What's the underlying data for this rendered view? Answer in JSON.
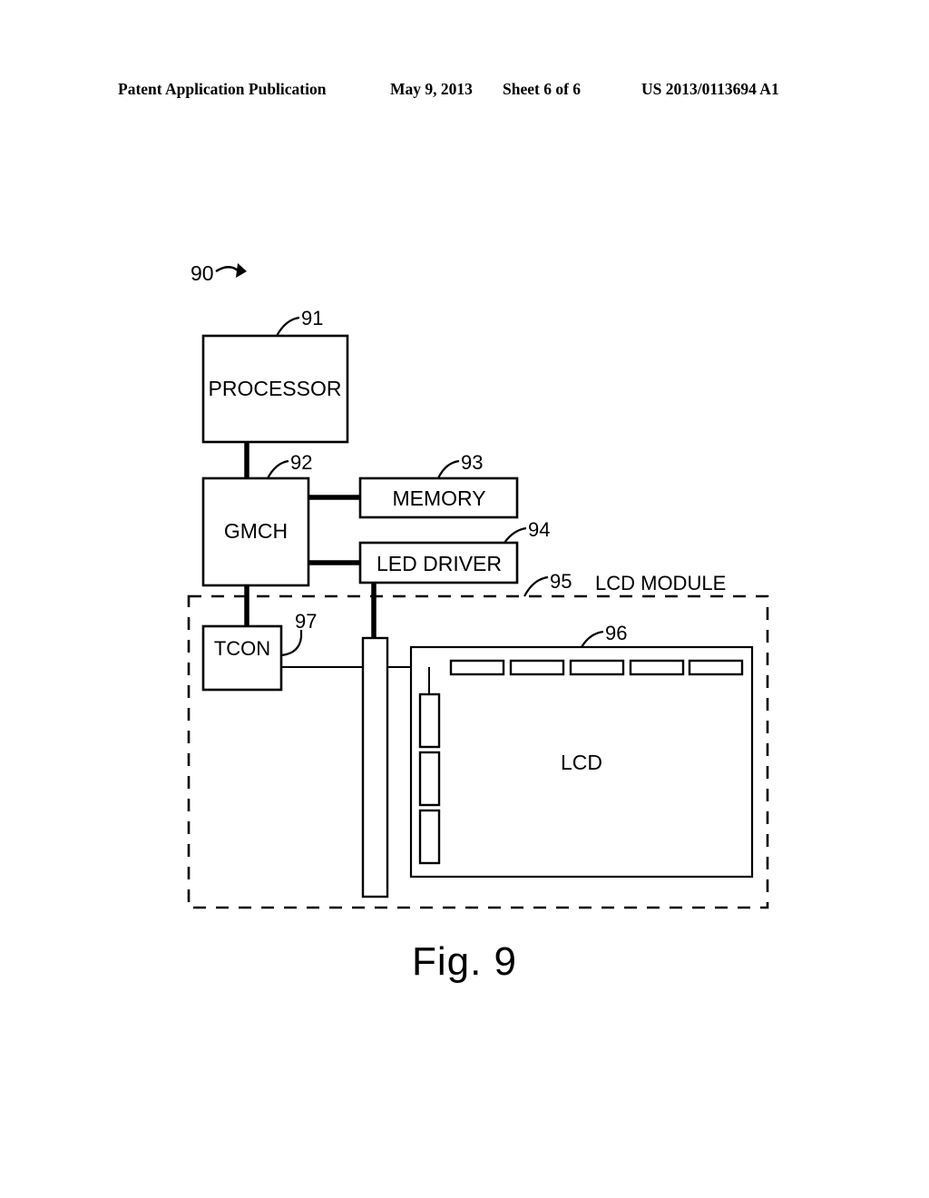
{
  "header": {
    "publication": "Patent Application Publication",
    "date": "May 9, 2013",
    "sheet": "Sheet 6 of 6",
    "patent_number": "US 2013/0113694 A1"
  },
  "figure": {
    "caption": "Fig. 9",
    "system_ref": "90",
    "module_label": "LCD MODULE",
    "module_ref": "95",
    "line_color": "#000000",
    "background": "#ffffff",
    "blocks": [
      {
        "id": "processor",
        "label": "PROCESSOR",
        "ref": "91"
      },
      {
        "id": "gmch",
        "label": "GMCH",
        "ref": "92"
      },
      {
        "id": "memory",
        "label": "MEMORY",
        "ref": "93"
      },
      {
        "id": "led-driver",
        "label": "LED DRIVER",
        "ref": "94"
      },
      {
        "id": "lcd",
        "label": "LCD",
        "ref": "96"
      },
      {
        "id": "tcon",
        "label": "TCON",
        "ref": "97"
      }
    ],
    "led_segments": {
      "top_count": 5,
      "left_count": 3
    }
  }
}
